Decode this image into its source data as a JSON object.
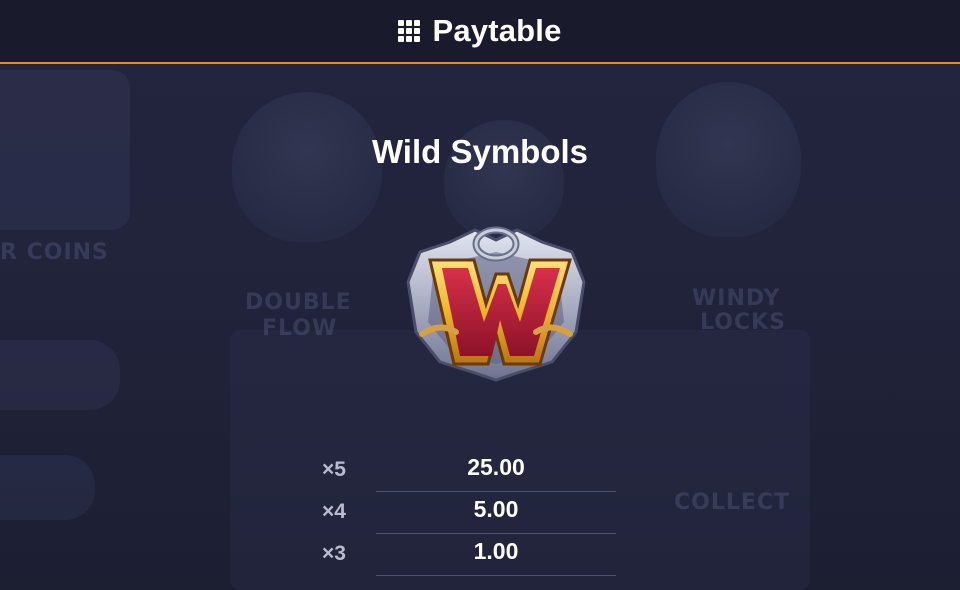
{
  "header": {
    "title": "Paytable",
    "icon": "grid-menu-icon"
  },
  "section": {
    "title": "Wild Symbols"
  },
  "symbol": {
    "name": "wild-w-symbol-icon",
    "letter": "W",
    "colors": {
      "letter": "#c4203a",
      "letter_border": "#f2c23a",
      "frame": "#b8bccc"
    }
  },
  "payouts": [
    {
      "count": "×5",
      "value": "25.00"
    },
    {
      "count": "×4",
      "value": "5.00"
    },
    {
      "count": "×3",
      "value": "1.00"
    }
  ],
  "colors": {
    "accent": "#e58b2b",
    "header_bg": "#191a2c",
    "page_bg": "#22243c"
  }
}
